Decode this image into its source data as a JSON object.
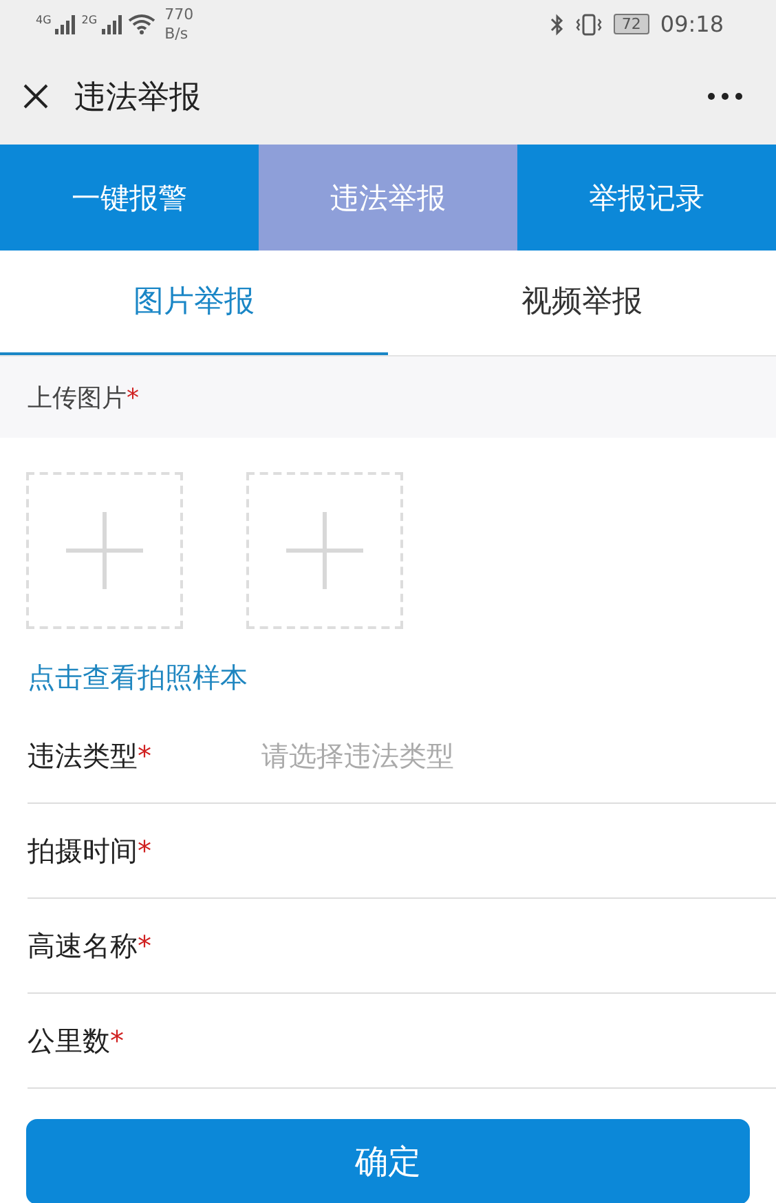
{
  "status_bar": {
    "net_1": "4G",
    "net_2": "2G",
    "speed": "770",
    "speed_unit": "B/s",
    "battery": "72",
    "time": "09:18"
  },
  "header": {
    "title": "违法举报"
  },
  "main_tabs": [
    {
      "label": "一键报警",
      "selected": false
    },
    {
      "label": "违法举报",
      "selected": true
    },
    {
      "label": "举报记录",
      "selected": false
    }
  ],
  "sub_tabs": [
    {
      "label": "图片举报",
      "selected": true
    },
    {
      "label": "视频举报",
      "selected": false
    }
  ],
  "upload": {
    "label": "上传图片",
    "required_mark": "*",
    "slots": [
      {
        "kind": "empty"
      },
      {
        "kind": "empty"
      }
    ]
  },
  "sample_link": "点击查看拍照样本",
  "fields": [
    {
      "label": "违法类型",
      "required_mark": "*",
      "placeholder": "请选择违法类型"
    },
    {
      "label": "拍摄时间",
      "required_mark": "*"
    },
    {
      "label": "高速名称",
      "required_mark": "*"
    },
    {
      "label": "公里数",
      "required_mark": "*"
    }
  ],
  "submit": "确定"
}
